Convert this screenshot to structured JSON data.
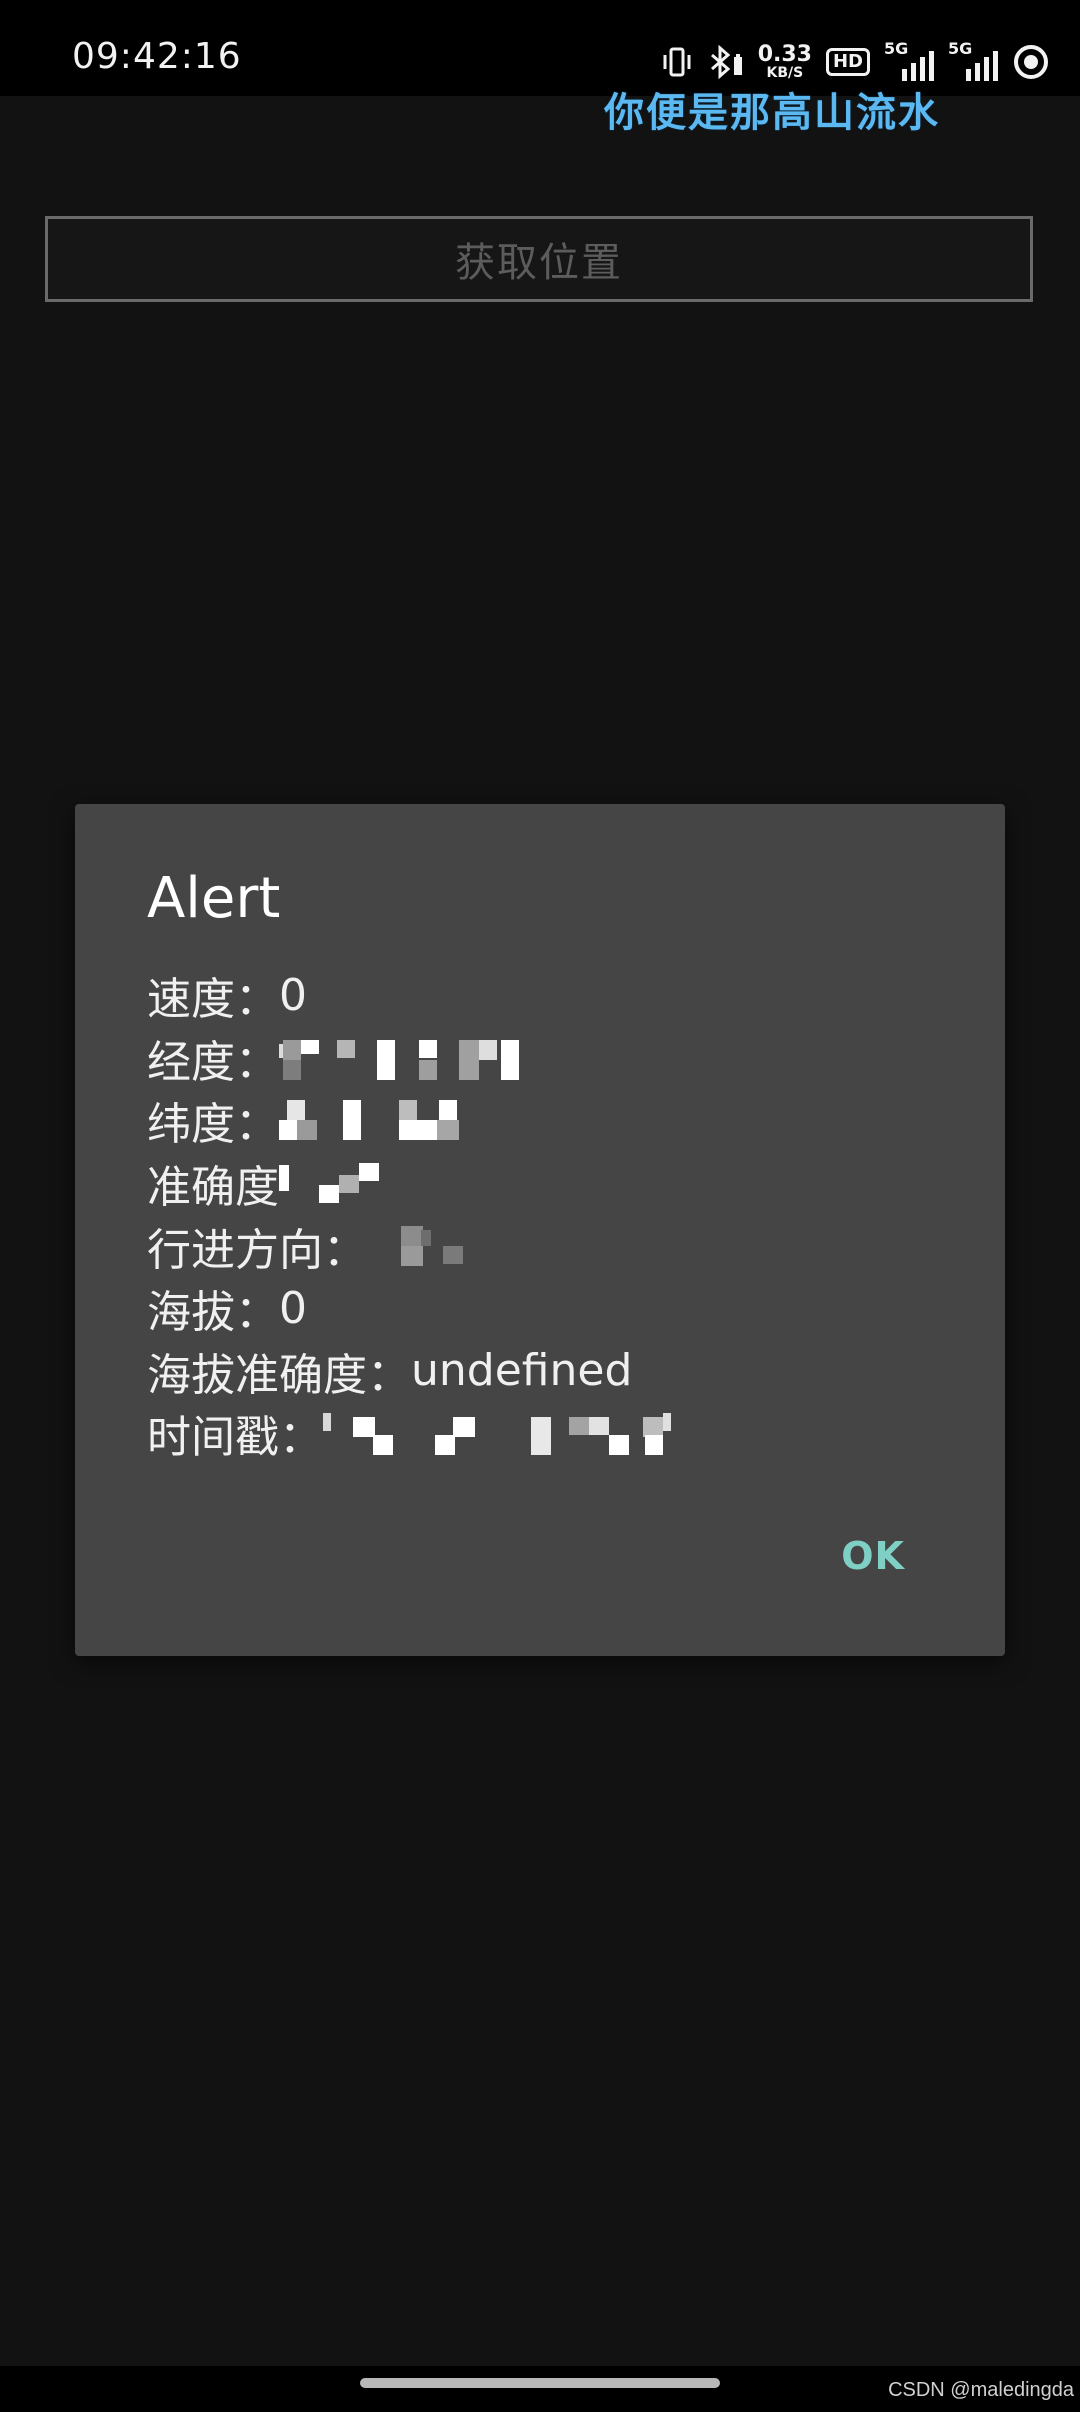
{
  "status_bar": {
    "time": "09:42:16",
    "net_speed_value": "0.33",
    "net_speed_unit": "KB/S",
    "hd_label": "HD",
    "sim1_tag": "5G",
    "sim2_tag": "5G",
    "icons": [
      "vibrate-icon",
      "bluetooth-battery-icon",
      "network-speed",
      "hd-volte-icon",
      "signal-sim1-icon",
      "signal-sim2-icon",
      "ring-status-icon"
    ]
  },
  "overlay_caption": "你便是那高山流水",
  "page": {
    "get_location_button": "获取位置"
  },
  "alert": {
    "title": "Alert",
    "lines": [
      {
        "label": "速度：",
        "value": "0"
      },
      {
        "label": "经度：",
        "value": ""
      },
      {
        "label": "纬度：",
        "value": ""
      },
      {
        "label": "准确度",
        "value": ""
      },
      {
        "label": "行进方向：",
        "value": ""
      },
      {
        "label": "海拔：",
        "value": "0"
      },
      {
        "label": "海拔准确度：",
        "value": "undefined"
      },
      {
        "label": "时间戳：",
        "value": ""
      }
    ],
    "ok_label": "OK"
  },
  "watermark": "CSDN @maledingda",
  "colors": {
    "background": "#121212",
    "dialog": "#454545",
    "accent_ok": "#7fcfc4",
    "caption": "#5bb8f0"
  }
}
